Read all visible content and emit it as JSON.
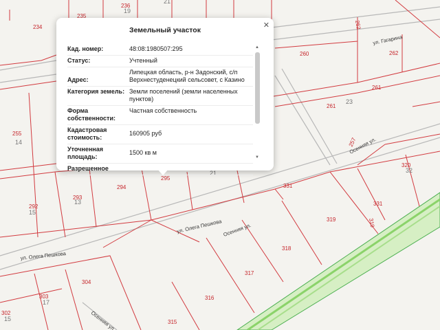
{
  "popup": {
    "title": "Земельный участок",
    "close_icon": "close-icon",
    "rows": [
      {
        "key": "Кад. номер:",
        "value": "48:08:1980507:295"
      },
      {
        "key": "Статус:",
        "value": "Учтенный"
      },
      {
        "key": "Адрес:",
        "value": "Липецкая область, р-н Задонский, с/п Верхнестуденецкий сельсовет, с Казино"
      },
      {
        "key": "Категория земель:",
        "value": "Земли поселений (земли населенных пунктов)"
      },
      {
        "key": "Форма собственности:",
        "value": "Частная собственность"
      },
      {
        "key": "Кадастровая стоимость:",
        "value": "160905 руб"
      },
      {
        "key": "Уточненная площадь:",
        "value": "1500 кв м"
      },
      {
        "key": "Разрешенное",
        "value": ""
      }
    ]
  },
  "map": {
    "parcels": [
      "234",
      "235",
      "236",
      "19",
      "21",
      "255",
      "14",
      "292",
      "15",
      "293",
      "13",
      "294",
      "295",
      "21",
      "331",
      "319",
      "318",
      "317",
      "316",
      "315",
      "304",
      "303",
      "17",
      "302",
      "15",
      "260",
      "262",
      "262",
      "261",
      "261",
      "23",
      "257",
      "320",
      "32"
    ],
    "streets": [
      "ул. Гагарина",
      "ул. Олега Пешкова",
      "ул. Олега Пешкова",
      "Осенняя ул.",
      "Осенняя ул.",
      "Осенняя ул."
    ]
  }
}
